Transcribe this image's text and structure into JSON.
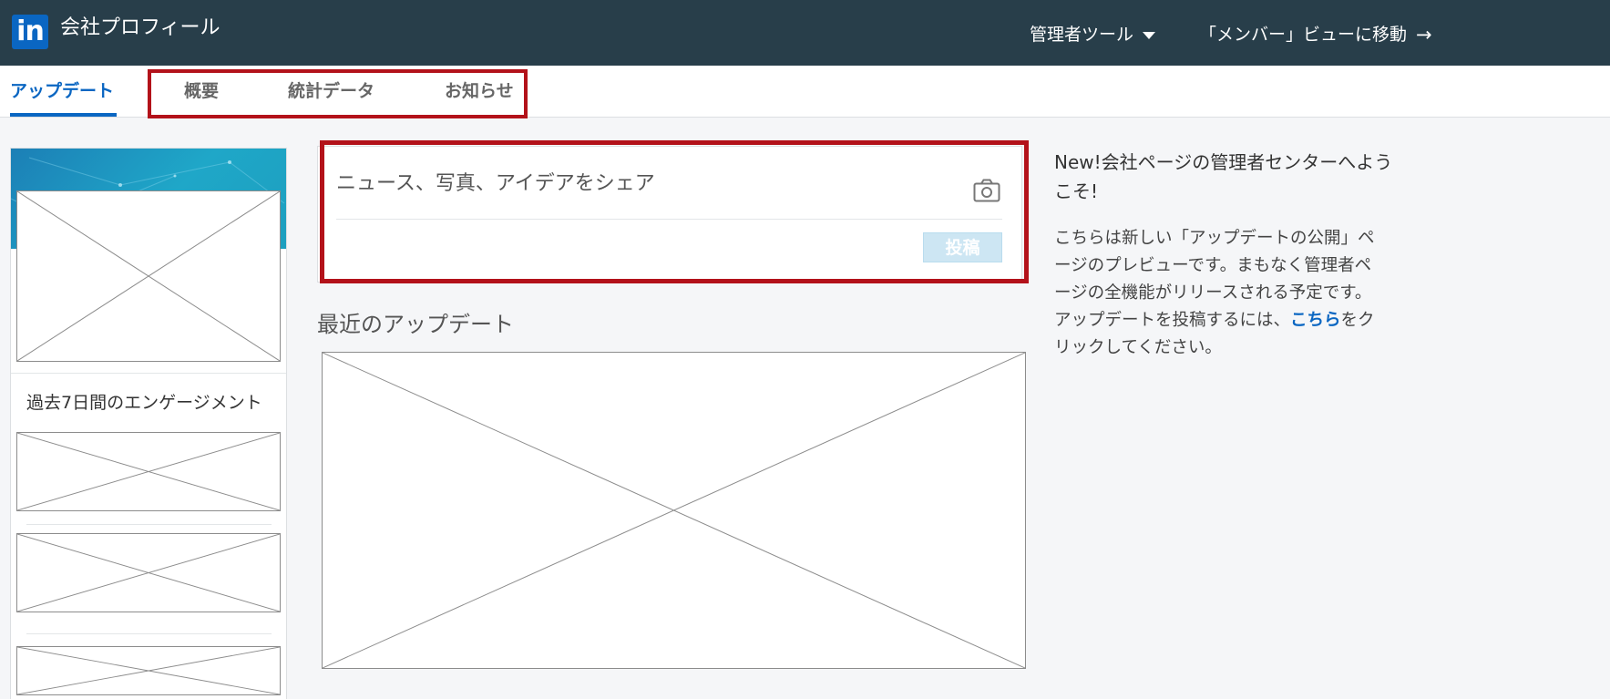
{
  "header": {
    "logo_text": "in",
    "title": "会社プロフィール",
    "admin_tools_label": "管理者ツール",
    "member_view_label": "「メンバー」ビューに移動",
    "brand_color": "#283e4a",
    "accent_color": "#0a66c2"
  },
  "tabs": [
    {
      "label": "アップデート",
      "active": true
    },
    {
      "label": "概要",
      "active": false
    },
    {
      "label": "統計データ",
      "active": false
    },
    {
      "label": "お知らせ",
      "active": false
    }
  ],
  "left_panel": {
    "engagement_title": "過去7日間のエンゲージメント"
  },
  "composer": {
    "placeholder": "ニュース、写真、アイデアをシェア",
    "post_button_label": "投稿"
  },
  "main": {
    "recent_updates_title": "最近のアップデート"
  },
  "right_panel": {
    "welcome_title": "New!会社ページの管理者センターへようこそ!",
    "welcome_body": "こちらは新しい「アップデートの公開」ページのプレビューです。まもなく管理者ページの全機能がリリースされる予定です。アップデートを投稿するには、",
    "welcome_link": "こちら",
    "welcome_suffix": "をクリックしてください。"
  },
  "highlight_color": "#b3121a"
}
